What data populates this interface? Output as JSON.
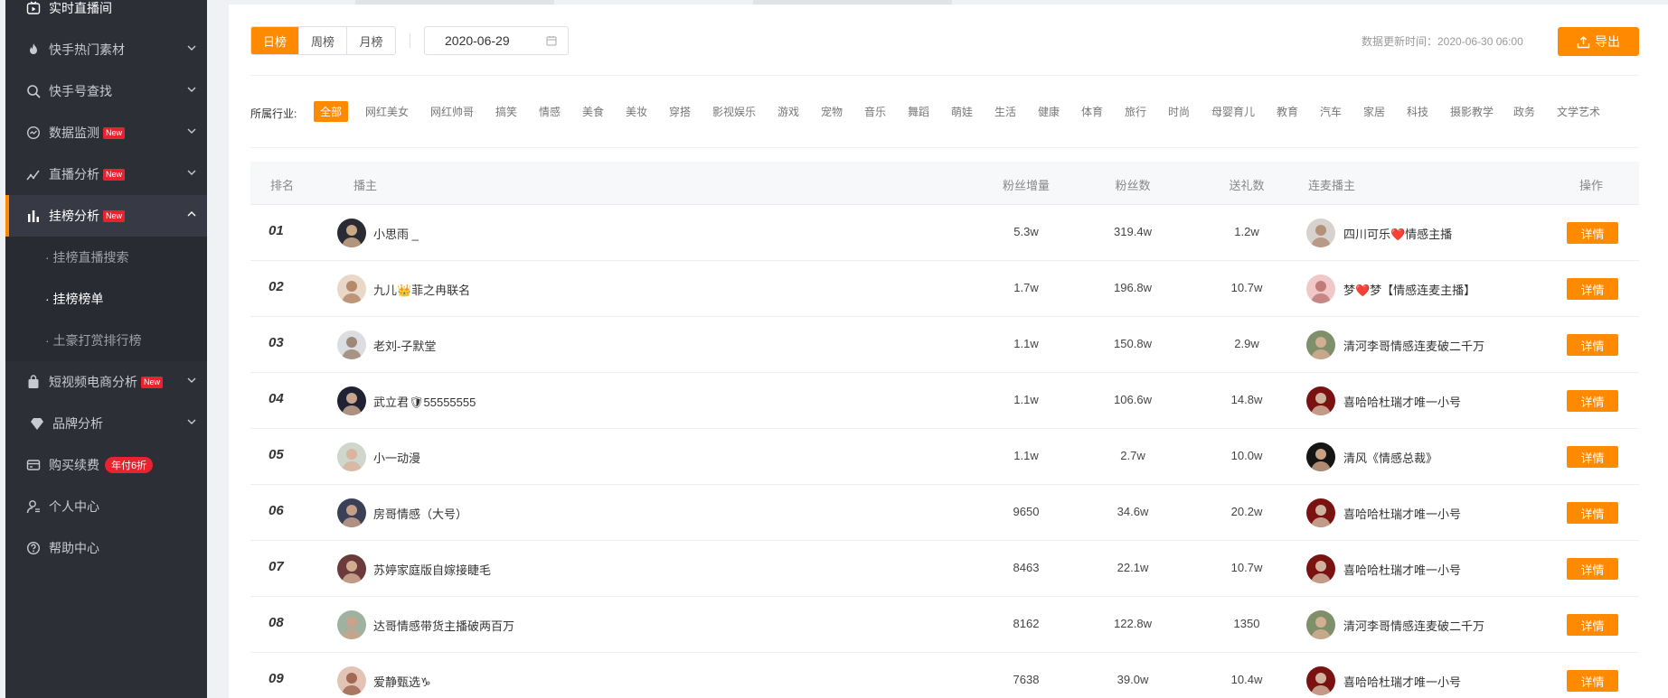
{
  "sidebar": {
    "items": [
      {
        "label": "实时直播间",
        "icon": "live-room-icon"
      },
      {
        "label": "快手热门素材",
        "icon": "fire-icon"
      },
      {
        "label": "快手号查找",
        "icon": "search-icon"
      },
      {
        "label": "数据监测",
        "icon": "monitor-icon",
        "badge": "New"
      },
      {
        "label": "直播分析",
        "icon": "trend-icon",
        "badge": "New"
      },
      {
        "label": "挂榜分析",
        "icon": "bar-chart-icon",
        "badge": "New"
      },
      {
        "label": "短视频电商分析",
        "icon": "shopping-bag-icon",
        "badge": "New"
      },
      {
        "label": "品牌分析",
        "icon": "diamond-icon"
      },
      {
        "label": "购买续费",
        "icon": "card-icon",
        "promo": "年付6折"
      },
      {
        "label": "个人中心",
        "icon": "user-icon"
      },
      {
        "label": "帮助中心",
        "icon": "help-icon"
      }
    ],
    "subitems": [
      "· 挂榜直播搜索",
      "· 挂榜榜单",
      "· 土豪打赏排行榜"
    ]
  },
  "filters": {
    "period_tabs": [
      "日榜",
      "周榜",
      "月榜"
    ],
    "date": "2020-06-29",
    "update_time": "数据更新时间：2020-06-30 06:00",
    "export_label": "导出"
  },
  "industry": {
    "label": "所属行业:",
    "options": [
      "全部",
      "网红美女",
      "网红帅哥",
      "搞笑",
      "情感",
      "美食",
      "美妆",
      "穿搭",
      "影视娱乐",
      "游戏",
      "宠物",
      "音乐",
      "舞蹈",
      "萌娃",
      "生活",
      "健康",
      "体育",
      "旅行",
      "时尚",
      "母婴育儿",
      "教育",
      "汽车",
      "家居",
      "科技",
      "摄影教学",
      "政务",
      "文学艺术"
    ]
  },
  "table": {
    "headers": {
      "rank": "排名",
      "host": "播主",
      "fan_growth": "粉丝增量",
      "fans": "粉丝数",
      "gifts": "送礼数",
      "co_host": "连麦播主",
      "action": "操作"
    },
    "action_label": "详情",
    "rows": [
      {
        "rank": "01",
        "host": "小思雨 _",
        "fan_growth": "5.3w",
        "fans": "319.4w",
        "gifts": "1.2w",
        "co_host": "四川可乐❤️情感主播"
      },
      {
        "rank": "02",
        "host": "九儿👑菲之冉联名",
        "fan_growth": "1.7w",
        "fans": "196.8w",
        "gifts": "10.7w",
        "co_host": "梦❤️梦【情感连麦主播】"
      },
      {
        "rank": "03",
        "host": "老刘-子默堂",
        "fan_growth": "1.1w",
        "fans": "150.8w",
        "gifts": "2.9w",
        "co_host": "清河李哥情感连麦破二千万"
      },
      {
        "rank": "04",
        "host": "武立君🛡55555555",
        "fan_growth": "1.1w",
        "fans": "106.6w",
        "gifts": "14.8w",
        "co_host": "喜哈哈杜瑞才唯一小号"
      },
      {
        "rank": "05",
        "host": "小一动漫",
        "fan_growth": "1.1w",
        "fans": "2.7w",
        "gifts": "10.0w",
        "co_host": "清风《情感总裁》"
      },
      {
        "rank": "06",
        "host": "房哥情感（大号）",
        "fan_growth": "9650",
        "fans": "34.6w",
        "gifts": "20.2w",
        "co_host": "喜哈哈杜瑞才唯一小号"
      },
      {
        "rank": "07",
        "host": "苏婷家庭版自嫁接睫毛",
        "fan_growth": "8463",
        "fans": "22.1w",
        "gifts": "10.7w",
        "co_host": "喜哈哈杜瑞才唯一小号"
      },
      {
        "rank": "08",
        "host": "达哥情感带货主播破两百万",
        "fan_growth": "8162",
        "fans": "122.8w",
        "gifts": "1350",
        "co_host": "清河李哥情感连麦破二千万"
      },
      {
        "rank": "09",
        "host": "爱静甄选♑",
        "fan_growth": "7638",
        "fans": "39.0w",
        "gifts": "10.4w",
        "co_host": "喜哈哈杜瑞才唯一小号"
      }
    ]
  },
  "colors": {
    "accent": "#ff8a00",
    "sidebar_bg": "#2d2f37",
    "badge_red": "#e8232f"
  }
}
